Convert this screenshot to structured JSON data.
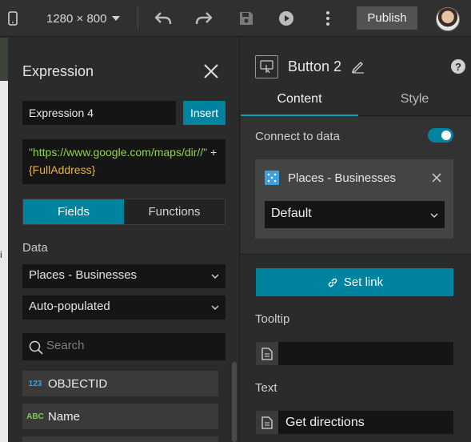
{
  "topbar": {
    "resolution": "1280 × 800",
    "publish_label": "Publish"
  },
  "expression_panel": {
    "title": "Expression",
    "name_value": "Expression 4",
    "insert_label": "Insert",
    "code": {
      "string_part": "\"https://www.google.com/maps/dir//\"",
      "operator": " + ",
      "field": "{FullAddress}"
    },
    "tabs": [
      {
        "label": "Fields",
        "active": true
      },
      {
        "label": "Functions",
        "active": false
      }
    ],
    "data_label": "Data",
    "data_source_select": "Places - Businesses",
    "view_select": "Auto-populated",
    "search_placeholder": "Search",
    "fields": [
      {
        "type": "123",
        "name": "OBJECTID"
      },
      {
        "type": "ABC",
        "name": "Name"
      }
    ]
  },
  "settings_panel": {
    "widget_title": "Button 2",
    "help": "?",
    "tabs": [
      {
        "label": "Content",
        "active": true
      },
      {
        "label": "Style",
        "active": false
      }
    ],
    "connect_label": "Connect to data",
    "connect_enabled": true,
    "data_source_name": "Places - Businesses",
    "data_view": "Default",
    "set_link_label": "Set link",
    "tooltip_label": "Tooltip",
    "tooltip_value": "",
    "text_label": "Text",
    "text_value": "Get directions"
  },
  "colors": {
    "accent": "#00839f",
    "code_string": "#8fd34a",
    "code_field": "#e8b24a",
    "type_number": "#3aa0e0",
    "type_string": "#7cd04a"
  }
}
